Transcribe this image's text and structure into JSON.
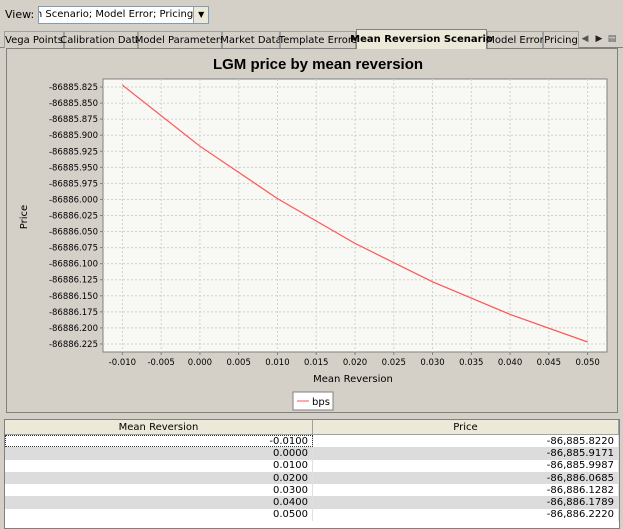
{
  "view": {
    "label": "View:",
    "value": "Mean Reversion Scenario; Model Error; Pricing"
  },
  "tabs": [
    {
      "label": "Vega Points",
      "active": false
    },
    {
      "label": "Calibration Data",
      "active": false
    },
    {
      "label": "Model Parameters",
      "active": false
    },
    {
      "label": "Market Data",
      "active": false
    },
    {
      "label": "Template Errors",
      "active": false
    },
    {
      "label": "Mean Reversion Scenario",
      "active": true
    },
    {
      "label": "Model Error",
      "active": false
    },
    {
      "label": "Pricing",
      "active": false
    }
  ],
  "chart_data": {
    "type": "line",
    "title": "LGM price by mean reversion",
    "xlabel": "Mean Reversion",
    "ylabel": "Price",
    "xlim": [
      -0.0125,
      0.0525
    ],
    "ylim": [
      -86886.2375,
      -86885.8125
    ],
    "x_ticks": [
      "-0.010",
      "-0.005",
      "0.000",
      "0.005",
      "0.010",
      "0.015",
      "0.020",
      "0.025",
      "0.030",
      "0.035",
      "0.040",
      "0.045",
      "0.050"
    ],
    "y_ticks": [
      "-86885.825",
      "-86885.850",
      "-86885.875",
      "-86885.900",
      "-86885.925",
      "-86885.950",
      "-86885.975",
      "-86886.000",
      "-86886.025",
      "-86886.050",
      "-86886.075",
      "-86886.100",
      "-86886.125",
      "-86886.150",
      "-86886.175",
      "-86886.200",
      "-86886.225"
    ],
    "grid": true,
    "legend_position": "bottom",
    "series": [
      {
        "name": "bps",
        "color": "#ff5555",
        "x": [
          -0.01,
          0.0,
          0.01,
          0.02,
          0.03,
          0.04,
          0.05
        ],
        "y": [
          -86885.822,
          -86885.9171,
          -86885.9987,
          -86886.0685,
          -86886.1282,
          -86886.1789,
          -86886.222
        ]
      }
    ]
  },
  "table": {
    "columns": [
      "Mean Reversion",
      "Price"
    ],
    "rows": [
      [
        "-0.0100",
        "-86,885.8220"
      ],
      [
        "0.0000",
        "-86,885.9171"
      ],
      [
        "0.0100",
        "-86,885.9987"
      ],
      [
        "0.0200",
        "-86,886.0685"
      ],
      [
        "0.0300",
        "-86,886.1282"
      ],
      [
        "0.0400",
        "-86,886.1789"
      ],
      [
        "0.0500",
        "-86,886.2220"
      ]
    ]
  }
}
